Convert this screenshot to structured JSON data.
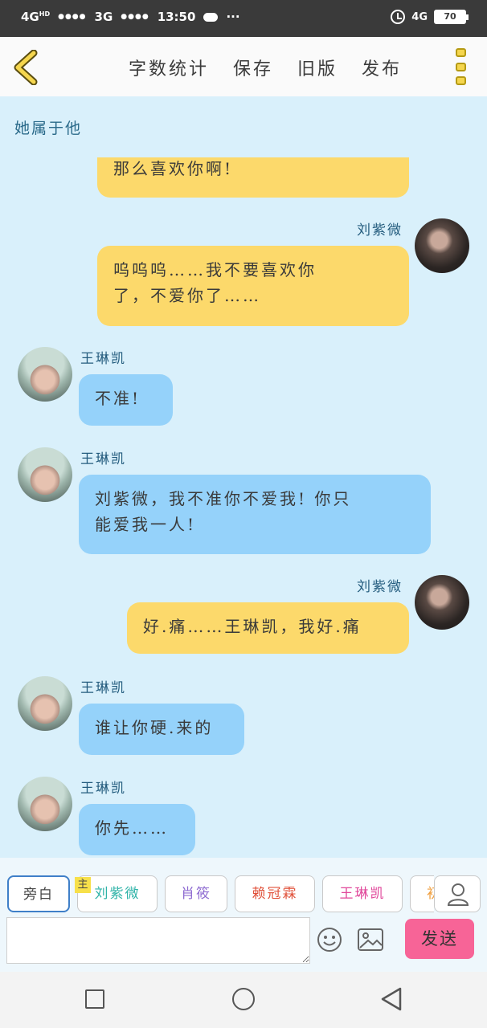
{
  "status_bar": {
    "network_1": "4G",
    "network_1_sup": "HD",
    "network_2": "3G",
    "time": "13:50",
    "more": "···",
    "network_right": "4G",
    "battery": "70"
  },
  "toolbar": {
    "word_count_label": "字数统计",
    "save_label": "保存",
    "old_version_label": "旧版",
    "publish_label": "发布"
  },
  "story_title": "她属于他",
  "messages": [
    {
      "side": "right",
      "speaker": "",
      "text": "那么喜欢你啊!"
    },
    {
      "side": "right",
      "speaker": "刘紫微",
      "text_line1": "呜呜呜……我不要喜欢你",
      "text_line2": "了，不爱你了……"
    },
    {
      "side": "left",
      "speaker": "王琳凯",
      "text": "不准!"
    },
    {
      "side": "left",
      "speaker": "王琳凯",
      "text_line1": "刘紫微，我不准你不爱我! 你只",
      "text_line2": "能爱我一人!"
    },
    {
      "side": "right",
      "speaker": "刘紫微",
      "text": "好.痛……王琳凯，我好.痛"
    },
    {
      "side": "left",
      "speaker": "王琳凯",
      "text": "谁让你硬.来的"
    },
    {
      "side": "left",
      "speaker": "王琳凯",
      "text": "你先……"
    }
  ],
  "roles": {
    "narrator": "旁白",
    "host_tag": "主",
    "role_1": "刘紫微",
    "role_2": "肖筱",
    "role_3": "赖冠霖",
    "role_4": "王琳凯",
    "role_5_partial": "初"
  },
  "input": {
    "placeholder": "",
    "send_label": "发送"
  },
  "colors": {
    "yellow_bubble": "#fcd96b",
    "blue_bubble": "#95d2fa",
    "background": "#d9f0fb",
    "send_button": "#f76497"
  }
}
